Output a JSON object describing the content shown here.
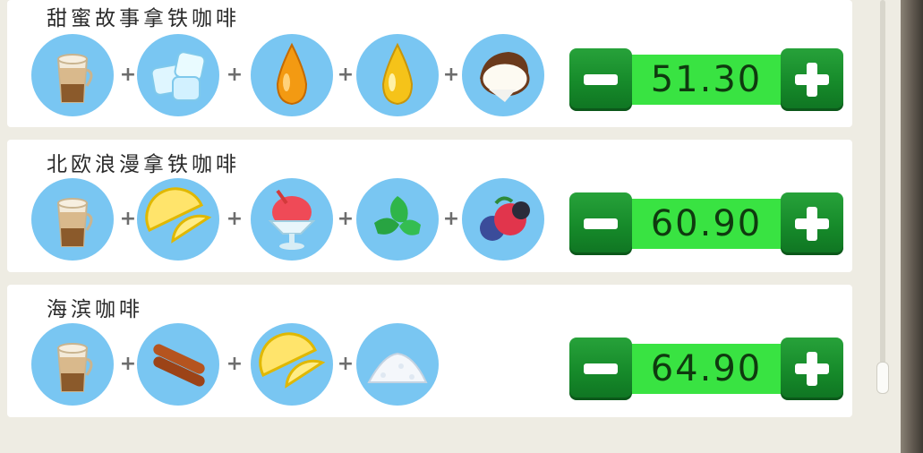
{
  "recipes": [
    {
      "name": "甜蜜故事拿铁咖啡",
      "ingredients": [
        "latte-icon",
        "ice-cubes-icon",
        "honey-drop-icon",
        "oil-drop-icon",
        "coconut-icon"
      ],
      "price": "51.30"
    },
    {
      "name": "北欧浪漫拿铁咖啡",
      "ingredients": [
        "latte-icon",
        "lemon-icon",
        "sundae-icon",
        "mint-icon",
        "berries-icon"
      ],
      "price": "60.90"
    },
    {
      "name": "海滨咖啡",
      "ingredients": [
        "latte-icon",
        "cinnamon-icon",
        "lemon-icon",
        "salt-icon"
      ],
      "price": "64.90"
    }
  ],
  "plus_sign": "+",
  "colors": {
    "ingredient_bg": "#79c6f2",
    "price_bar": "#39e342",
    "button_green": "#168a2a"
  }
}
